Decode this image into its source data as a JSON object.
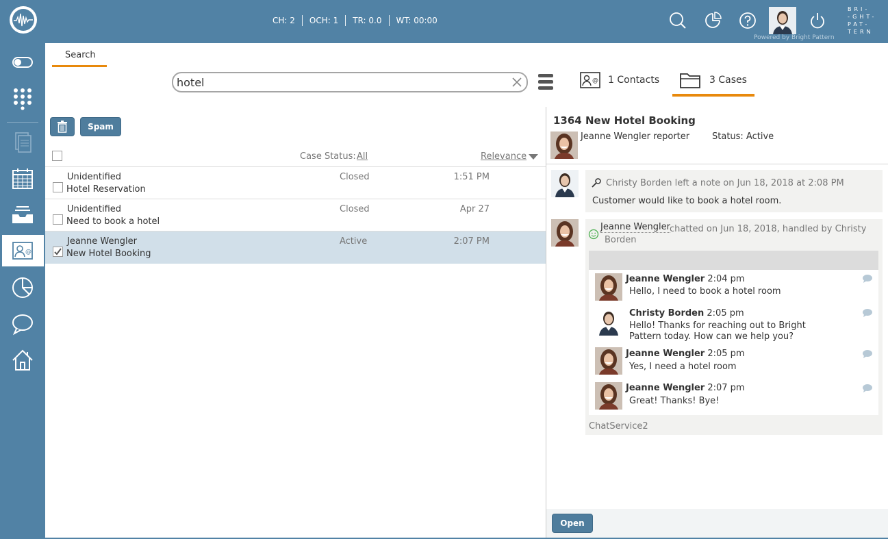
{
  "topbar": {
    "stats": [
      "CH: 2",
      "OCH: 1",
      "TR: 0.0",
      "WT: 00:00"
    ],
    "powered_by": "Powered by Bright Pattern",
    "brand_lines": [
      "BRI-",
      "-GHT-",
      "PAT-",
      "TERN"
    ]
  },
  "rail": {
    "items": [
      "toggle-icon",
      "dialpad-icon",
      "documents-icon",
      "calendar-icon",
      "inbox-icon",
      "contacts-icon",
      "reports-icon",
      "chat-icon",
      "home-icon"
    ],
    "active": "contacts-icon"
  },
  "tabs": {
    "search_label": "Search"
  },
  "search": {
    "query": "hotel"
  },
  "results_tabs": {
    "contacts_label": "1 Contacts",
    "cases_label": "3 Cases"
  },
  "toolbar": {
    "spam_label": "Spam"
  },
  "list": {
    "case_status_label": "Case Status:",
    "case_status_value": "All",
    "sort_label": "Relevance",
    "rows": [
      {
        "name": "Unidentified",
        "subject": "Hotel Reservation",
        "status": "Closed",
        "time": "1:51 PM",
        "checked": false
      },
      {
        "name": "Unidentified",
        "subject": "Need to book a hotel",
        "status": "Closed",
        "time": "Apr 27",
        "checked": false
      },
      {
        "name": "Jeanne Wengler",
        "subject": "New Hotel Booking",
        "status": "Active",
        "time": "2:07 PM",
        "checked": true
      }
    ]
  },
  "case": {
    "title": "1364  New Hotel Booking",
    "reporter": "Jeanne Wengler reporter",
    "status": "Status: Active"
  },
  "note": {
    "header": "Christy Borden left a note on Jun 18, 2018 at 2:08 PM",
    "text": "Customer would like to book a hotel room."
  },
  "chat": {
    "name": "Jeanne Wengler",
    "meta_line1": "chatted on Jun 18, 2018, handled by Christy",
    "meta_line2": "Borden",
    "messages": [
      {
        "author": "Jeanne Wengler",
        "time": "2:04 pm",
        "line1": "Hello, I need to book a hotel room",
        "line2": ""
      },
      {
        "author": "Christy Borden",
        "time": "2:05 pm",
        "line1": "Hello! Thanks for reaching out to Bright",
        "line2": "Pattern today. How can we help you?"
      },
      {
        "author": "Jeanne Wengler",
        "time": "2:05 pm",
        "line1": "Yes, I need a hotel room",
        "line2": ""
      },
      {
        "author": "Jeanne Wengler",
        "time": "2:07 pm",
        "line1": "Great! Thanks! Bye!",
        "line2": ""
      }
    ],
    "service": "ChatService2"
  },
  "footer": {
    "open_label": "Open"
  },
  "colors": {
    "primary": "#5182a5",
    "accent": "#e8890c",
    "button": "#4f7d9d",
    "selected_row": "#d1dfe9"
  }
}
